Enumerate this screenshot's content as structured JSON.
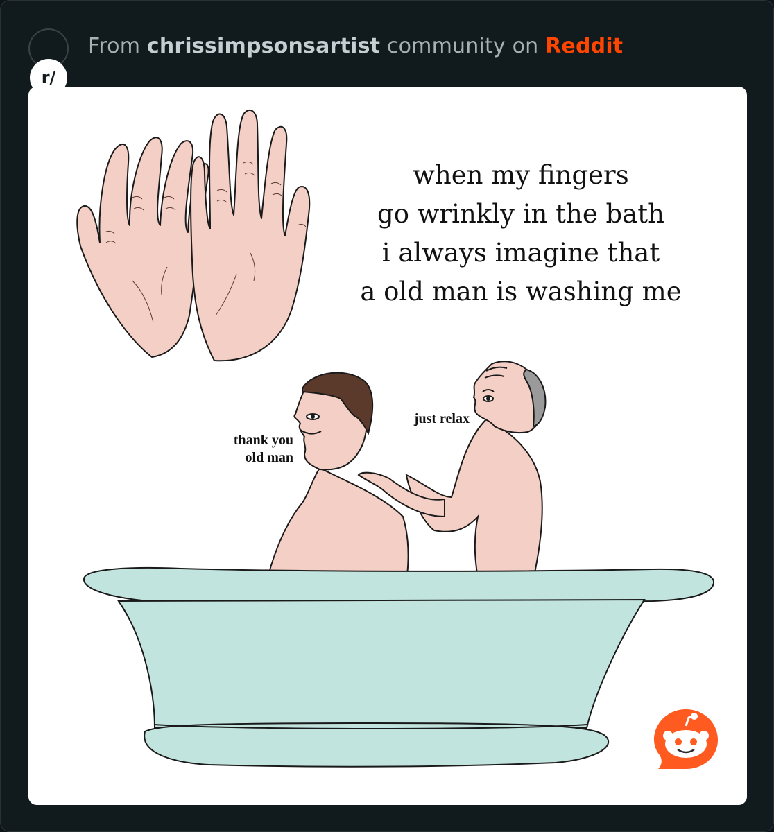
{
  "header": {
    "subreddit_badge": "r/",
    "prefix": "From ",
    "community": "chrissimpsonsartist",
    "middle": " community on ",
    "brand": "Reddit"
  },
  "meme": {
    "caption_lines": [
      "when my fingers",
      "go wrinkly in the bath",
      "i always imagine that",
      "a old man is washing me"
    ],
    "young_man_line_1": "thank you",
    "young_man_line_2": "old man",
    "old_man_line": "just relax"
  },
  "colors": {
    "page_background": "#111a1d",
    "card_background": "#ffffff",
    "brand": "#ff4500",
    "skin": "#f4cfc5",
    "tub": "#c2e4df",
    "hair_young": "#5b3a2c",
    "hair_old": "#9a9a9a"
  },
  "icons": {
    "subreddit": "subreddit-avatar-icon",
    "reddit": "reddit-snoo-icon"
  }
}
